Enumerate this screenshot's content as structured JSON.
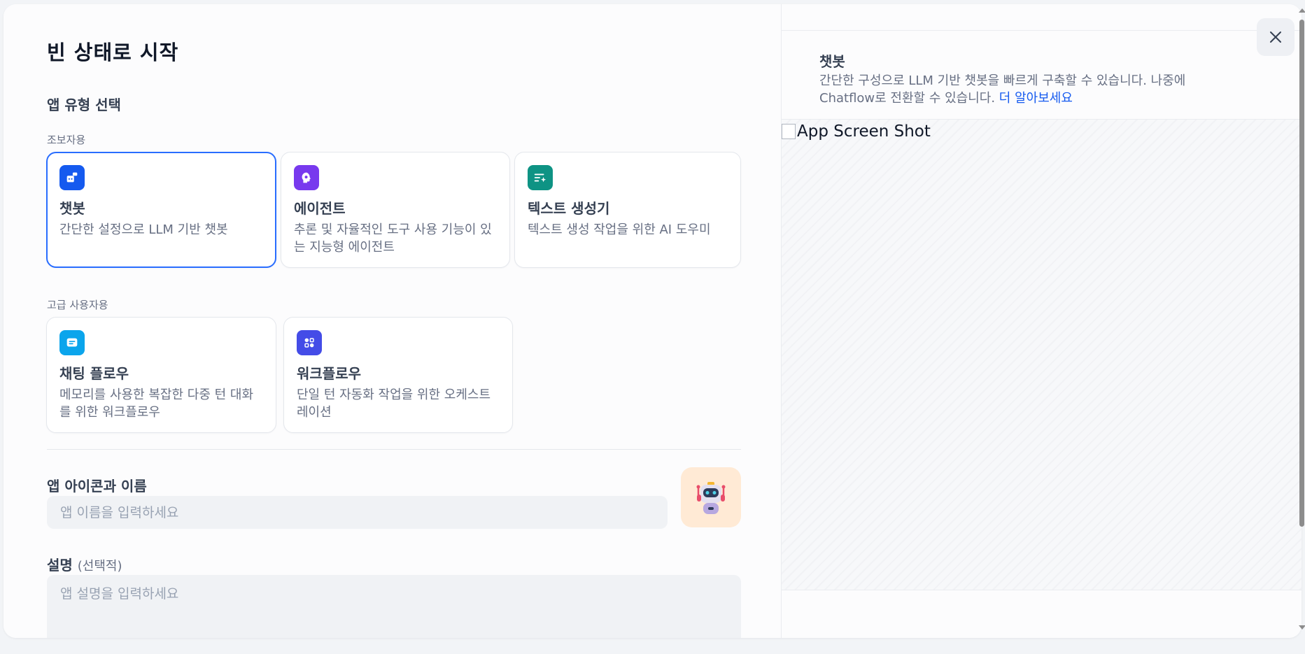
{
  "modal": {
    "title": "빈 상태로 시작",
    "app_type_title": "앱 유형 선택",
    "groups": {
      "beginner_label": "조보자용",
      "advanced_label": "고급 사용자용"
    },
    "cards": [
      {
        "title": "챗봇",
        "desc": "간단한 설정으로 LLM 기반 챗봇",
        "icon": "chatbot-icon",
        "color": "#155aef",
        "selected": true
      },
      {
        "title": "에이전트",
        "desc": "추론 및 자율적인 도구 사용 기능이 있는 지능형 에이전트",
        "icon": "agent-icon",
        "color": "#7839ee",
        "selected": false
      },
      {
        "title": "텍스트 생성기",
        "desc": "텍스트 생성 작업을 위한 AI 도우미",
        "icon": "text-generator-icon",
        "color": "#0e9384",
        "selected": false
      },
      {
        "title": "채팅 플로우",
        "desc": "메모리를 사용한 복잡한 다중 턴 대화를 위한 워크플로우",
        "icon": "chatflow-icon",
        "color": "#0ba5ec",
        "selected": false
      },
      {
        "title": "워크플로우",
        "desc": "단일 턴 자동화 작업을 위한 오케스트레이션",
        "icon": "workflow-icon",
        "color": "#444ce7",
        "selected": false
      }
    ],
    "name_section": {
      "label": "앱 아이콘과 이름",
      "placeholder": "앱 이름을 입력하세요",
      "app_icon": "robot-emoji-icon",
      "app_icon_bg": "#ffead5"
    },
    "description_section": {
      "label": "설명",
      "optional": "(선택적)",
      "placeholder": "앱 설명을 입력하세요"
    }
  },
  "preview": {
    "title": "챗봇",
    "desc": "간단한 구성으로 LLM 기반 챗봇을 빠르게 구축할 수 있습니다. 나중에 Chatflow로 전환할 수 있습니다.",
    "link": "더 알아보세요",
    "image_alt": "App Screen Shot"
  },
  "accent_color": "#296dff"
}
